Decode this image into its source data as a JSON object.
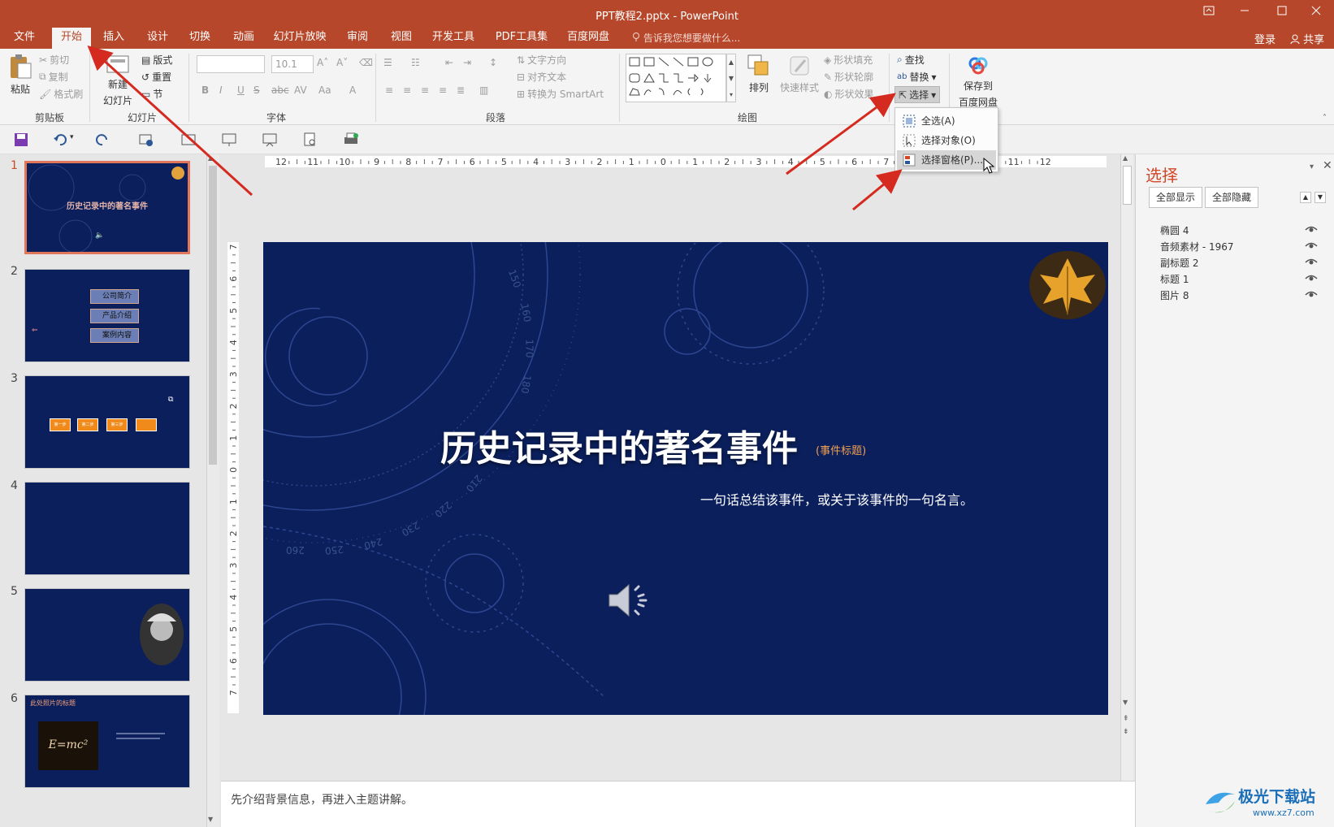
{
  "window": {
    "title": "PPT教程2.pptx - PowerPoint",
    "login": "登录",
    "share": "共享"
  },
  "tabs": [
    {
      "label": "文件"
    },
    {
      "label": "开始",
      "active": true
    },
    {
      "label": "插入"
    },
    {
      "label": "设计"
    },
    {
      "label": "切换"
    },
    {
      "label": "动画"
    },
    {
      "label": "幻灯片放映"
    },
    {
      "label": "审阅"
    },
    {
      "label": "视图"
    },
    {
      "label": "开发工具"
    },
    {
      "label": "PDF工具集"
    },
    {
      "label": "百度网盘"
    }
  ],
  "tellme": "告诉我您想要做什么...",
  "ribbon": {
    "clipboard": {
      "label": "剪贴板",
      "paste": "粘贴",
      "cut": "剪切",
      "copy": "复制",
      "format_painter": "格式刷"
    },
    "slides": {
      "label": "幻灯片",
      "new_slide_1": "新建",
      "new_slide_2": "幻灯片",
      "layout": "版式",
      "reset": "重置",
      "section": "节"
    },
    "font": {
      "label": "字体",
      "font_size": "10.1"
    },
    "paragraph": {
      "label": "段落",
      "text_direction": "文字方向",
      "align_text": "对齐文本",
      "smartart": "转换为 SmartArt"
    },
    "drawing": {
      "label": "绘图",
      "arrange": "排列",
      "quick_styles": "快速样式",
      "shape_fill": "形状填充",
      "shape_outline": "形状轮廓",
      "shape_effects": "形状效果"
    },
    "editing": {
      "find": "查找",
      "replace": "替换",
      "select": "选择"
    },
    "baidu": {
      "save_1": "保存到",
      "save_2": "百度网盘"
    }
  },
  "select_menu": [
    {
      "label": "全选(A)"
    },
    {
      "label": "选择对象(O)"
    },
    {
      "label": "选择窗格(P)...",
      "highlighted": true
    }
  ],
  "ruler": {
    "h_ticks": [
      "12",
      "11",
      "10",
      "9",
      "8",
      "7",
      "6",
      "5",
      "4",
      "3",
      "2",
      "1",
      "0",
      "1",
      "2",
      "3",
      "4",
      "5",
      "6",
      "7",
      "8",
      "9",
      "10",
      "11",
      "12"
    ],
    "v_ticks": [
      "7",
      "6",
      "5",
      "4",
      "3",
      "2",
      "1",
      "0",
      "1",
      "2",
      "3",
      "4",
      "5",
      "6",
      "7"
    ]
  },
  "thumbnails": [
    {
      "num": "1",
      "selected": true,
      "title": "历史记录中的著名事件"
    },
    {
      "num": "2",
      "items": [
        "公司简介",
        "产品介绍",
        "案例内容"
      ]
    },
    {
      "num": "3",
      "steps": [
        "第一步",
        "第二步",
        "第三步"
      ]
    },
    {
      "num": "4"
    },
    {
      "num": "5"
    },
    {
      "num": "6",
      "title": "此处照片的标题",
      "formula": "E=mc²"
    }
  ],
  "slide": {
    "title": "历史记录中的著名事件",
    "tag": "(事件标题)",
    "subtitle": "一句话总结该事件，或关于该事件的一句名言。",
    "dial_labels": [
      "150",
      "160",
      "170",
      "180",
      "210",
      "220",
      "230",
      "240",
      "250",
      "260"
    ]
  },
  "notes": "先介绍背景信息，再进入主题讲解。",
  "selection_pane": {
    "title": "选择",
    "show_all": "全部显示",
    "hide_all": "全部隐藏",
    "layers": [
      "椭圆 4",
      "音频素材 - 1967",
      "副标题 2",
      "标题 1",
      "图片 8"
    ]
  },
  "watermark": {
    "name": "极光下载站",
    "url": "www.xz7.com"
  },
  "colors": {
    "accent": "#b7472a",
    "slide_bg": "#0b1f5c",
    "pane_title": "#d24726",
    "annotation_arrow": "#d42a1f"
  }
}
